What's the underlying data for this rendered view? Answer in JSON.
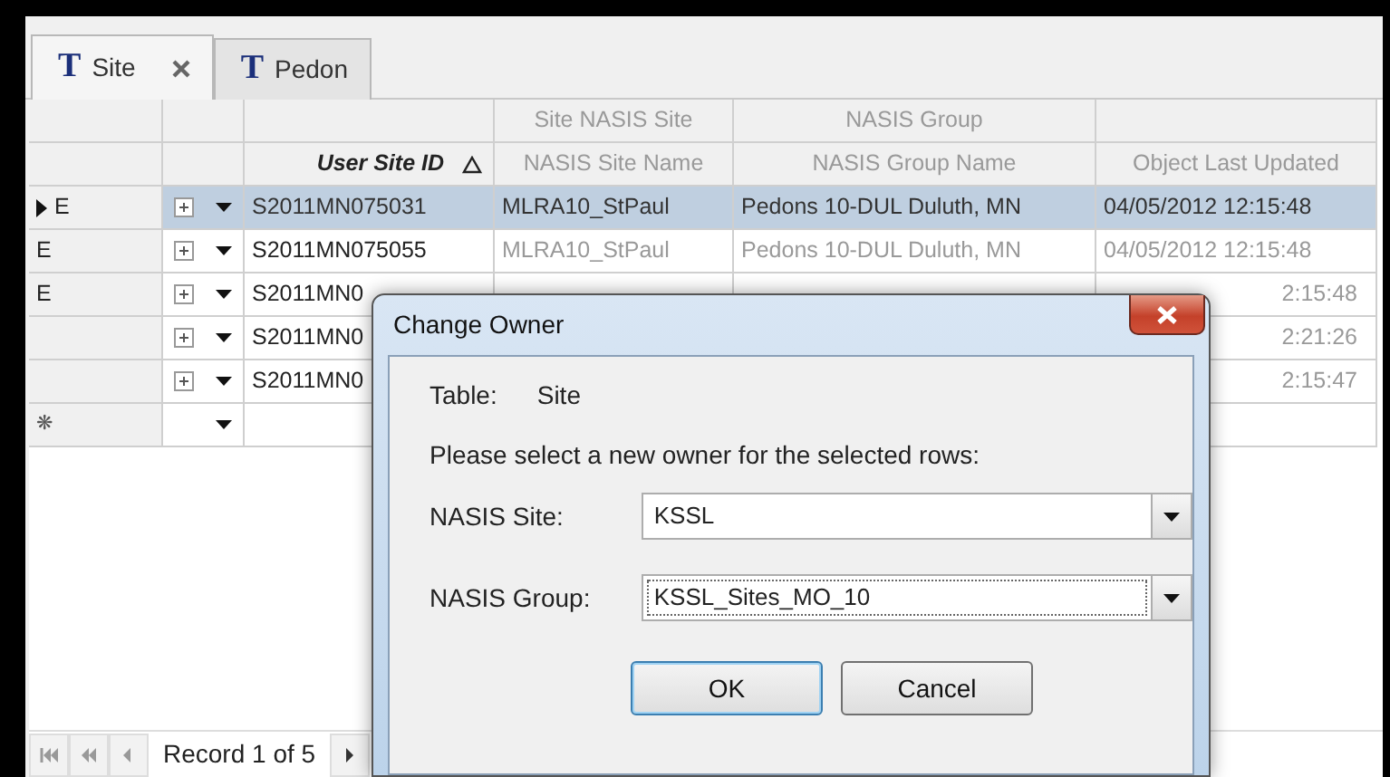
{
  "tabs": [
    {
      "icon": "T",
      "label": "Site",
      "selected": true,
      "closable": true
    },
    {
      "icon": "T",
      "label": "Pedon",
      "selected": false,
      "closable": false
    }
  ],
  "grid": {
    "columns": [
      {
        "label": "User Site ID",
        "sorted": true,
        "readonly": false
      },
      {
        "group": "Site NASIS Site",
        "label": "NASIS Site Name",
        "sorted": false,
        "readonly": true
      },
      {
        "group": "NASIS Group",
        "label": "NASIS Group Name",
        "sorted": false,
        "readonly": true
      },
      {
        "label": "Object Last Updated",
        "sorted": false,
        "readonly": true
      }
    ],
    "rows": [
      {
        "marker": "E",
        "current": true,
        "selected": true,
        "cells": [
          "S2011MN075031",
          "MLRA10_StPaul",
          "Pedons 10-DUL Duluth, MN",
          "04/05/2012 12:15:48"
        ]
      },
      {
        "marker": "E",
        "current": false,
        "selected": false,
        "cells": [
          "S2011MN075055",
          "MLRA10_StPaul",
          "Pedons 10-DUL Duluth, MN",
          "04/05/2012 12:15:48"
        ]
      },
      {
        "marker": "E",
        "current": false,
        "selected": false,
        "cells": [
          "S2011MN0",
          null,
          null,
          "2:15:48"
        ]
      },
      {
        "current": false,
        "selected": false,
        "cells": [
          "S2011MN0",
          null,
          null,
          "2:21:26"
        ]
      },
      {
        "current": false,
        "selected": false,
        "cells": [
          "S2011MN0",
          null,
          null,
          "2:15:47"
        ]
      }
    ],
    "new_row": {
      "marker": "❋"
    }
  },
  "pager": {
    "text": "Record 1 of 5"
  },
  "dialog": {
    "title": "Change Owner",
    "table_label": "Table:",
    "table_value": "Site",
    "prompt": "Please select a new owner for the selected rows:",
    "fields": [
      {
        "label": "NASIS Site:",
        "value": "KSSL",
        "focused": false
      },
      {
        "label": "NASIS Group:",
        "value": "KSSL_Sites_MO_10",
        "focused": true
      }
    ],
    "buttons": [
      {
        "label": "OK",
        "default": true
      },
      {
        "label": "Cancel",
        "default": false
      }
    ]
  }
}
